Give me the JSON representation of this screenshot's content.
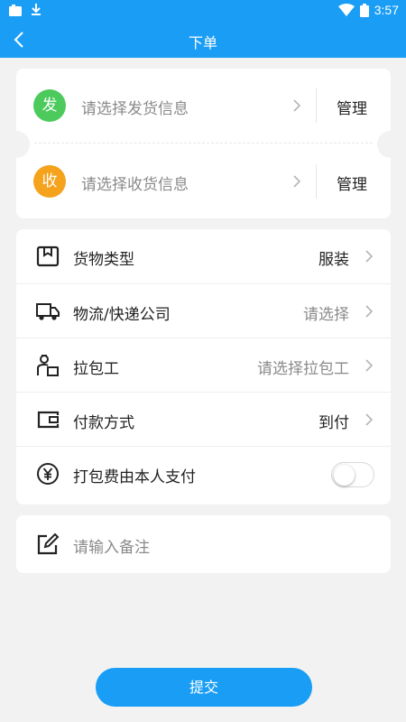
{
  "status_bar": {
    "time": "3:57"
  },
  "toolbar": {
    "title": "下单"
  },
  "address": {
    "send": {
      "badge": "发",
      "placeholder": "请选择发货信息",
      "manage_label": "管理"
    },
    "receive": {
      "badge": "收",
      "placeholder": "请选择收货信息",
      "manage_label": "管理"
    }
  },
  "options": {
    "goods_type": {
      "label": "货物类型",
      "value": "服装"
    },
    "logistics": {
      "label": "物流/快递公司",
      "value": "请选择"
    },
    "packer": {
      "label": "拉包工",
      "value": "请选择拉包工"
    },
    "payment": {
      "label": "付款方式",
      "value": "到付"
    },
    "packing_fee": {
      "label": "打包费由本人支付",
      "toggle_on": false
    }
  },
  "remark": {
    "placeholder": "请输入备注"
  },
  "submit": {
    "label": "提交"
  },
  "colors": {
    "primary": "#1a9ef5",
    "send_badge": "#4cca5c",
    "receive_badge": "#f5a21c",
    "background": "#f2f2f2"
  }
}
